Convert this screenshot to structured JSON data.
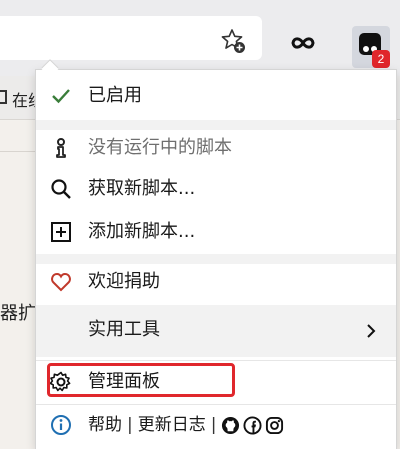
{
  "toolbar": {
    "extension_badge": "2"
  },
  "bookmarks": {
    "first_label": "在线"
  },
  "page": {
    "fragment_text": "器扩"
  },
  "menu": {
    "items": [
      {
        "label": "已启用",
        "icon": "check-icon"
      },
      {
        "label": "没有运行中的脚本",
        "icon": "info-figure-icon"
      },
      {
        "label": "获取新脚本...",
        "icon": "search-icon"
      },
      {
        "label": "添加新脚本...",
        "icon": "plus-box-icon"
      },
      {
        "label": "欢迎捐助",
        "icon": "heart-icon"
      },
      {
        "label": "实用工具",
        "icon": "chevron-right-icon"
      },
      {
        "label": "管理面板",
        "icon": "gear-icon"
      }
    ],
    "footer": {
      "help": "帮助",
      "changelog": "更新日志",
      "sep": "|"
    }
  },
  "colors": {
    "check": "#3a7d3a",
    "heart": "#c0392b",
    "info": "#1f6fb2",
    "highlight": "#e0272c",
    "badge": "#e0262b"
  }
}
